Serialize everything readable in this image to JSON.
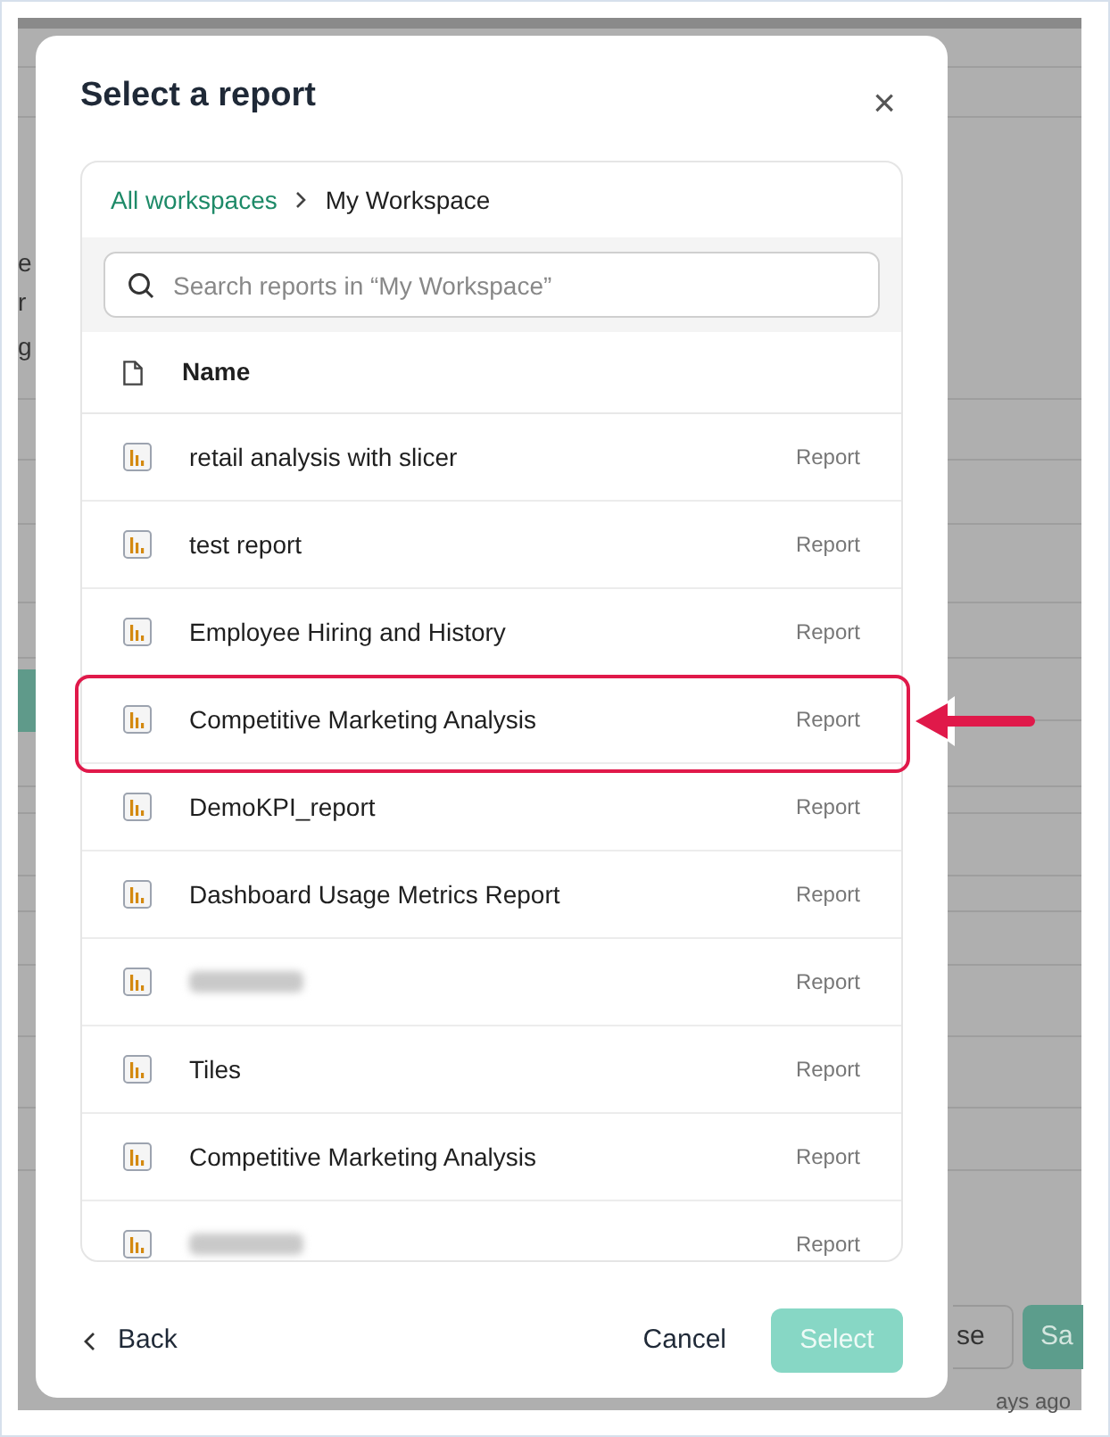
{
  "background": {
    "fragments": [
      {
        "text": "e"
      },
      {
        "text": "r"
      },
      {
        "text": "g"
      }
    ],
    "buttons": [
      {
        "label": "se",
        "kind": "outline"
      },
      {
        "label": "Sa",
        "kind": "primary"
      }
    ],
    "footnote": "ays ago"
  },
  "dialog": {
    "title": "Select a report",
    "close": "×",
    "breadcrumb": [
      {
        "label": "All workspaces",
        "kind": "link"
      },
      {
        "label": "My Workspace",
        "kind": "current"
      }
    ],
    "search": {
      "placeholder": "Search reports in “My Workspace”"
    },
    "columns": [
      "Name"
    ],
    "rows": [
      {
        "name": "retail analysis with slicer",
        "type": "Report",
        "selected": false,
        "blurred": false
      },
      {
        "name": "test report",
        "type": "Report",
        "selected": false,
        "blurred": false
      },
      {
        "name": "Employee Hiring and History",
        "type": "Report",
        "selected": false,
        "blurred": false
      },
      {
        "name": "Competitive Marketing Analysis",
        "type": "Report",
        "selected": true,
        "blurred": false
      },
      {
        "name": "DemoKPI_report",
        "type": "Report",
        "selected": false,
        "blurred": false
      },
      {
        "name": "Dashboard Usage Metrics Report",
        "type": "Report",
        "selected": false,
        "blurred": false
      },
      {
        "type": "Report",
        "selected": false,
        "blurred": true
      },
      {
        "name": "Tiles",
        "type": "Report",
        "selected": false,
        "blurred": false
      },
      {
        "name": "Competitive Marketing Analysis",
        "type": "Report",
        "selected": false,
        "blurred": false
      },
      {
        "type": "Report",
        "selected": false,
        "blurred": true
      }
    ],
    "back": "Back",
    "cancel": "Cancel",
    "select": {
      "label": "Select",
      "disabled": true
    }
  }
}
